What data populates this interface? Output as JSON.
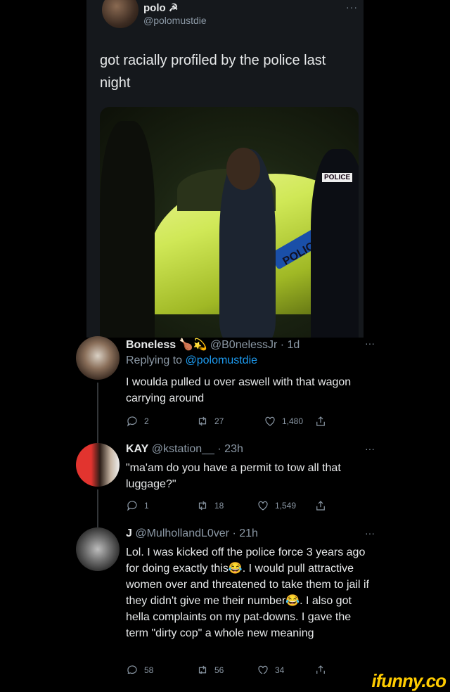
{
  "tweet": {
    "name": "polo ☭",
    "handle": "@polomustdie",
    "more": "···",
    "text": "got racially profiled by the police last night",
    "photo_text": {
      "badge": "POLICE",
      "car": "POLICE"
    }
  },
  "replies": [
    {
      "name": "Boneless",
      "handle_time": "@B0nelessJr · 1d",
      "replying_prefix": "Replying to ",
      "replying_handle": "@polomustdie",
      "text": "I woulda pulled u over aswell with that wagon carrying around",
      "counts": {
        "reply": "2",
        "retweet": "27",
        "like": "1,480"
      }
    },
    {
      "name": "KAY",
      "handle_time": "@kstation__ · 23h",
      "text": "\"ma'am do you have a permit to tow all that luggage?\"",
      "counts": {
        "reply": "1",
        "retweet": "18",
        "like": "1,549"
      }
    },
    {
      "name": "J",
      "handle_time": "@MulhollandL0ver · 21h",
      "text": "Lol. I was kicked off the police force 3 years ago for doing exactly this😂. I would pull attractive women over and threatened to take them to jail if they didn't give me their number😂. I also got hella complaints on my pat-downs. I gave the term \"dirty cop\" a whole new meaning",
      "counts": {
        "reply": "58",
        "retweet": "56",
        "like": "34"
      }
    }
  ],
  "more": "···",
  "watermark": "ifunny.co"
}
